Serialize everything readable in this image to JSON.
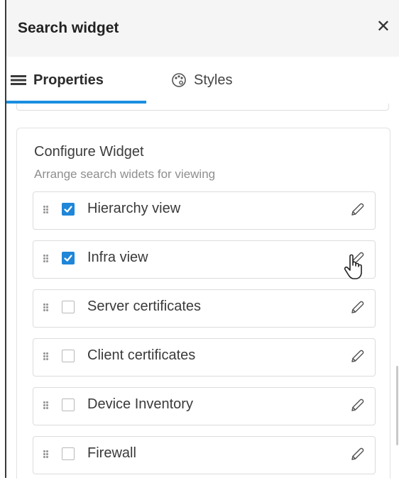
{
  "header": {
    "title": "Search widget",
    "close_icon": "close-icon"
  },
  "tabs": [
    {
      "label": "Properties",
      "icon": "list-icon",
      "active": true
    },
    {
      "label": "Styles",
      "icon": "palette-icon",
      "active": false
    }
  ],
  "colors": {
    "accent": "#1a8fe0",
    "checkbox_checked": "#1f86d8"
  },
  "configure": {
    "title": "Configure Widget",
    "subtitle": "Arrange search widets for viewing",
    "items": [
      {
        "label": "Hierarchy view",
        "checked": true
      },
      {
        "label": "Infra view",
        "checked": true
      },
      {
        "label": "Server certificates",
        "checked": false
      },
      {
        "label": "Client certificates",
        "checked": false
      },
      {
        "label": "Device Inventory",
        "checked": false
      },
      {
        "label": "Firewall",
        "checked": false
      }
    ]
  }
}
